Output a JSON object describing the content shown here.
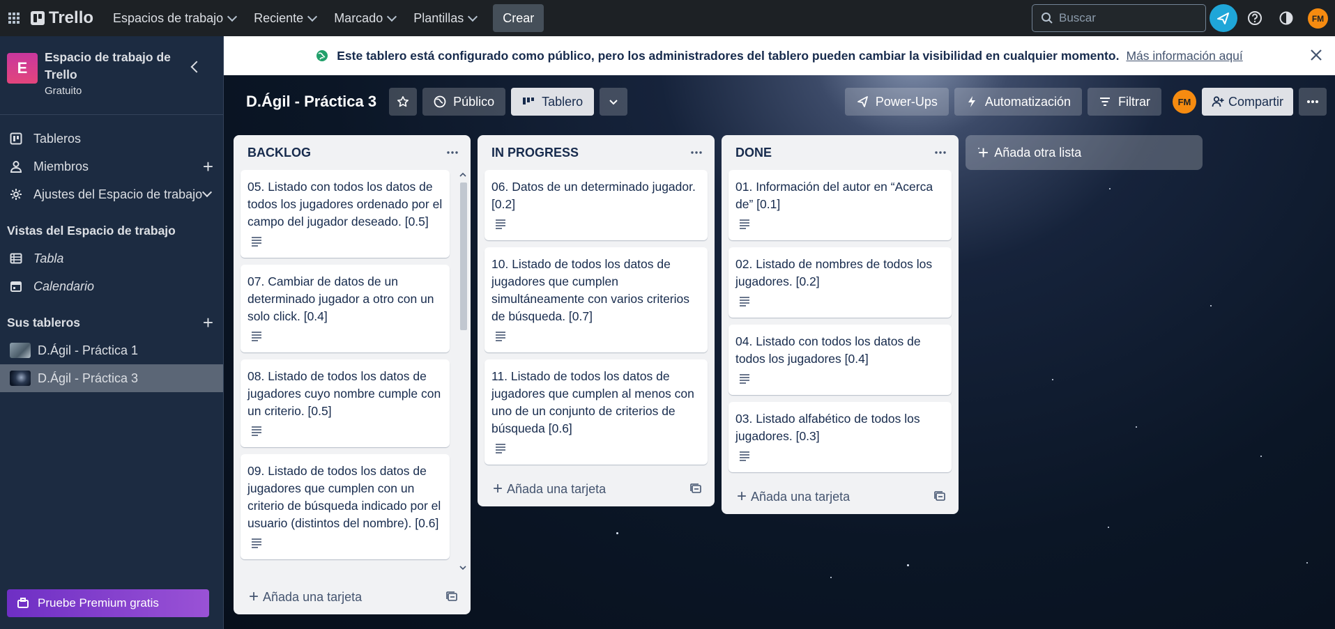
{
  "topbar": {
    "app_name": "Trello",
    "nav": [
      {
        "label": "Espacios de trabajo"
      },
      {
        "label": "Reciente"
      },
      {
        "label": "Marcado"
      },
      {
        "label": "Plantillas"
      }
    ],
    "create_label": "Crear",
    "search_placeholder": "Buscar",
    "avatar_initials": "FM",
    "icons": [
      "apps-grid-icon",
      "notification-icon",
      "help-icon",
      "theme-icon"
    ]
  },
  "sidebar": {
    "workspace_initial": "E",
    "workspace_name": "Espacio de trabajo de Trello",
    "workspace_plan": "Gratuito",
    "items": [
      {
        "label": "Tableros",
        "icon": "board-icon"
      },
      {
        "label": "Miembros",
        "icon": "person-icon"
      },
      {
        "label": "Ajustes del Espacio de trabajo",
        "icon": "gear-icon"
      }
    ],
    "views_heading": "Vistas del Espacio de trabajo",
    "views": [
      {
        "label": "Tabla",
        "icon": "table-icon"
      },
      {
        "label": "Calendario",
        "icon": "calendar-icon"
      }
    ],
    "boards_heading": "Sus tableros",
    "boards": [
      {
        "label": "D.Ágil - Práctica 1"
      },
      {
        "label": "D.Ágil - Práctica 3"
      }
    ],
    "premium_label": "Pruebe Premium gratis"
  },
  "banner": {
    "text": "Este tablero está configurado como público, pero los administradores del tablero pueden cambiar la visibilidad en cualquier momento.",
    "link": "Más información aquí"
  },
  "board": {
    "title": "D.Ágil - Práctica 3",
    "visibility_label": "Público",
    "view_label": "Tablero",
    "powerups_label": "Power-Ups",
    "automation_label": "Automatización",
    "filter_label": "Filtrar",
    "share_label": "Compartir",
    "avatar_initials": "FM"
  },
  "lists": [
    {
      "title": "BACKLOG",
      "cards": [
        "05. Listado con todos los datos de todos los jugadores ordenado por el campo del jugador deseado. [0.5]",
        "07. Cambiar de datos de un determinado jugador a otro con un solo click. [0.4]",
        "08. Listado de todos los datos de jugadores cuyo nombre cumple con un criterio. [0.5]",
        "09. Listado de todos los datos de jugadores que cumplen con un criterio de búsqueda indicado por el usuario (distintos del nombre). [0.6]"
      ],
      "add_card_label": "Añada una tarjeta"
    },
    {
      "title": "IN PROGRESS",
      "cards": [
        "06. Datos de un determinado jugador. [0.2]",
        "10. Listado de todos los datos de jugadores que cumplen simultáneamente con varios criterios de búsqueda. [0.7]",
        "11. Listado de todos los datos de jugadores que cumplen al menos con uno de un conjunto de criterios de búsqueda [0.6]"
      ],
      "add_card_label": "Añada una tarjeta"
    },
    {
      "title": "DONE",
      "cards": [
        "01. Información del autor en “Acerca de” [0.1]",
        "02. Listado de nombres de todos los jugadores. [0.2]",
        "04. Listado con todos los datos de todos los jugadores [0.4]",
        "03. Listado alfabético de todos los jugadores. [0.3]"
      ],
      "add_card_label": "Añada una tarjeta"
    }
  ],
  "add_list_label": "Añada otra lista",
  "colors": {
    "topbar": "#1d2125",
    "sidebar": "#1c2b41",
    "list_bg": "#f1f2f4",
    "premium": "#8a46d0",
    "notification": "#1fa6d8",
    "avatar": "#f68b10",
    "workspace_badge": "#d93f8c"
  }
}
